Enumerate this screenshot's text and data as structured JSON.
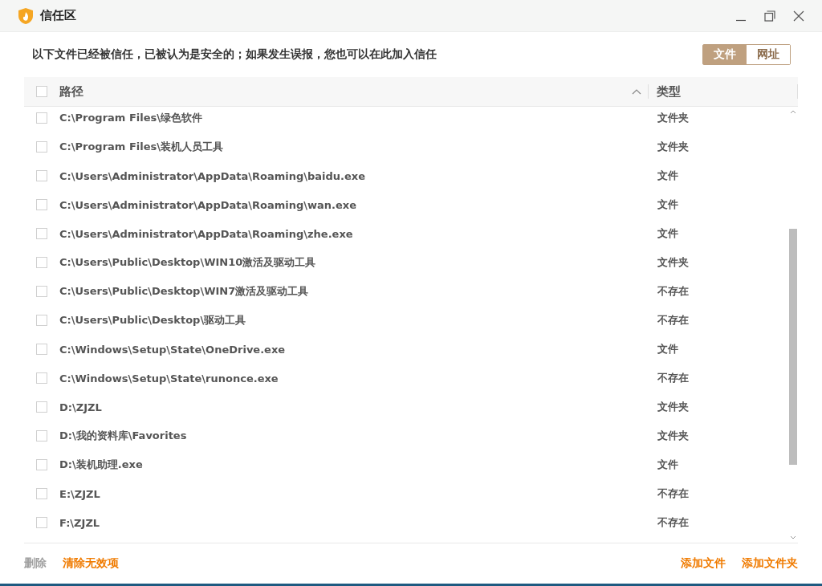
{
  "window": {
    "title": "信任区"
  },
  "notice": "以下文件已经被信任，已被认为是安全的；如果发生误报，您也可以在此加入信任",
  "tabs": [
    {
      "label": "文件",
      "selected": true
    },
    {
      "label": "网址",
      "selected": false
    }
  ],
  "table": {
    "select_all": {
      "checked": false
    },
    "columns": [
      {
        "label": "路径",
        "sorted": true
      },
      {
        "label": "类型",
        "sorted": false
      }
    ],
    "rows": [
      {
        "checked": false,
        "path": "C:\\Program Files\\绿色软件",
        "type": "文件夹"
      },
      {
        "checked": false,
        "path": "C:\\Program Files\\装机人员工具",
        "type": "文件夹"
      },
      {
        "checked": false,
        "path": "C:\\Users\\Administrator\\AppData\\Roaming\\baidu.exe",
        "type": "文件"
      },
      {
        "checked": false,
        "path": "C:\\Users\\Administrator\\AppData\\Roaming\\wan.exe",
        "type": "文件"
      },
      {
        "checked": false,
        "path": "C:\\Users\\Administrator\\AppData\\Roaming\\zhe.exe",
        "type": "文件"
      },
      {
        "checked": false,
        "path": "C:\\Users\\Public\\Desktop\\WIN10激活及驱动工具",
        "type": "文件夹"
      },
      {
        "checked": false,
        "path": "C:\\Users\\Public\\Desktop\\WIN7激活及驱动工具",
        "type": "不存在"
      },
      {
        "checked": false,
        "path": "C:\\Users\\Public\\Desktop\\驱动工具",
        "type": "不存在"
      },
      {
        "checked": false,
        "path": "C:\\Windows\\Setup\\State\\OneDrive.exe",
        "type": "文件"
      },
      {
        "checked": false,
        "path": "C:\\Windows\\Setup\\State\\runonce.exe",
        "type": "不存在"
      },
      {
        "checked": false,
        "path": "D:\\ZJZL",
        "type": "文件夹"
      },
      {
        "checked": false,
        "path": "D:\\我的资料库\\Favorites",
        "type": "文件夹"
      },
      {
        "checked": false,
        "path": "D:\\装机助理.exe",
        "type": "文件"
      },
      {
        "checked": false,
        "path": "E:\\ZJZL",
        "type": "不存在"
      },
      {
        "checked": false,
        "path": "F:\\ZJZL",
        "type": "不存在"
      }
    ]
  },
  "footer": {
    "left": [
      {
        "label": "删除",
        "disabled": true
      },
      {
        "label": "清除无效项",
        "disabled": false
      }
    ],
    "right": [
      {
        "label": "添加文件",
        "disabled": false
      },
      {
        "label": "添加文件夹",
        "disabled": false
      }
    ]
  }
}
